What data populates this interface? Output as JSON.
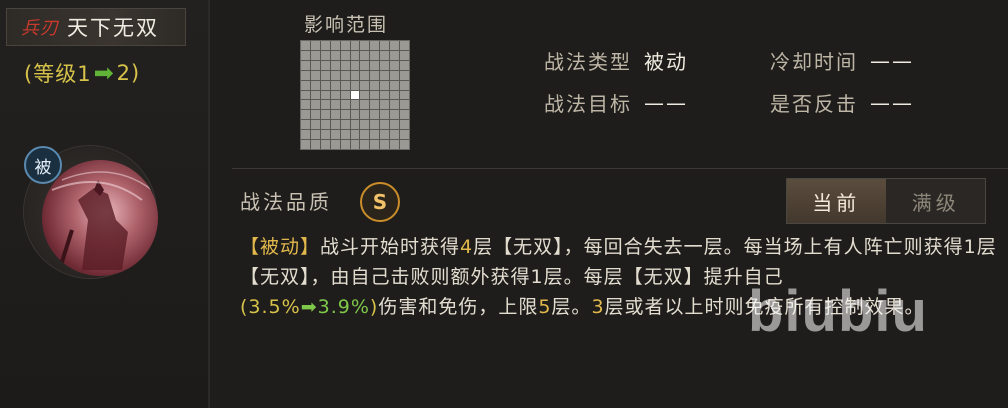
{
  "skill": {
    "weapon_tag": "兵刃",
    "name": "天下无双",
    "level_prefix": "(等级1",
    "level_suffix": "2)",
    "passive_badge": "被"
  },
  "range": {
    "title": "影响范围",
    "grid_rows": 11,
    "grid_cols": 11,
    "highlight_cell": [
      5,
      5
    ]
  },
  "info": {
    "type_label": "战法类型",
    "type_value": "被动",
    "cooldown_label": "冷却时间",
    "cooldown_value": "——",
    "target_label": "战法目标",
    "target_value": "——",
    "counter_label": "是否反击",
    "counter_value": "——"
  },
  "quality": {
    "label": "战法品质",
    "grade": "S"
  },
  "toggle": {
    "current": "当前",
    "max": "满级"
  },
  "description": {
    "tag": "【被动】",
    "p1": "战斗开始时获得",
    "n1": "4",
    "p2": "层【无双】，每回合失去一层。每当场上有人阵亡则获得1层【无双】，由自己击败则额外获得1层。每层【无双】提升自己",
    "pct_open": "(3.5%",
    "pct_new": "3.9%",
    "pct_close": ")",
    "p3": "伤害和免伤，上限",
    "n2": "5",
    "p4": "层。",
    "n3": "3",
    "p5": "层或者以上时则免疫所有控制效果。"
  },
  "watermark": "biubiu",
  "icons": {
    "arrow": "arrow-right-icon"
  },
  "colors": {
    "highlight_gold": "#e1b84b",
    "highlight_green": "#7ec84a",
    "weapon_red": "#c83a2c"
  }
}
